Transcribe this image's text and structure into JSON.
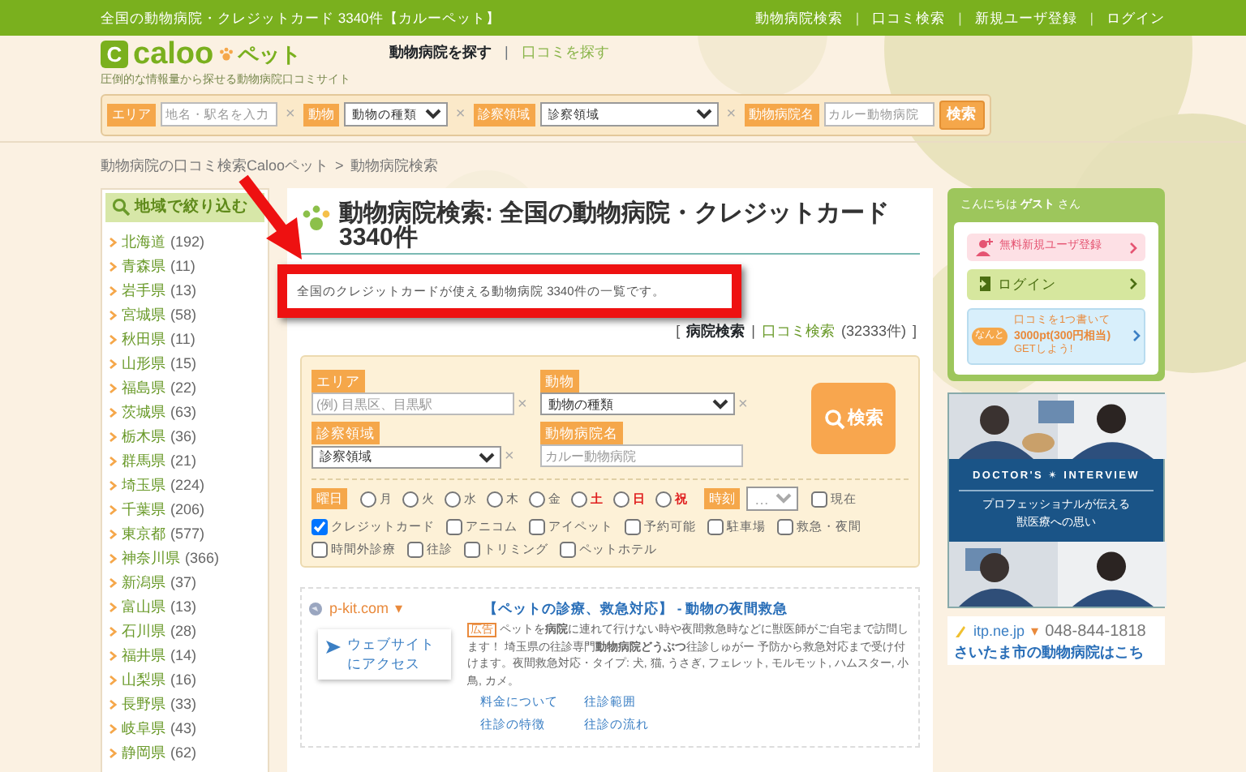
{
  "top_bar": {
    "title": "全国の動物病院・クレジットカード 3340件【カルーペット】",
    "links": [
      "動物病院検索",
      "口コミ検索",
      "新規ユーザ登録",
      "ログイン"
    ],
    "separator": "|"
  },
  "header": {
    "logo": {
      "mark": "C",
      "name": "caloo",
      "suffix": "ペット"
    },
    "tagline": "圧倒的な情報量から探せる動物病院口コミサイト",
    "nav": [
      {
        "label": "動物病院を探す",
        "selected": true
      },
      {
        "label": "口コミを探す",
        "selected": false
      }
    ],
    "separator": "|"
  },
  "search_bar": {
    "fields": [
      {
        "label": "エリア",
        "kind": "input",
        "placeholder": "地名・駅名を入力",
        "clear": "×"
      },
      {
        "label": "動物",
        "kind": "select",
        "value": "動物の種類",
        "clear": "×"
      },
      {
        "label": "診察領域",
        "kind": "select",
        "value": "診察領域",
        "clear": "×"
      },
      {
        "label": "動物病院名",
        "kind": "input",
        "placeholder": "カルー動物病院"
      }
    ],
    "button": "検索"
  },
  "breadcrumb": [
    "動物病院の口コミ検索Calooペット",
    ">",
    "動物病院検索"
  ],
  "sidebar": {
    "heading": "地域で絞り込む",
    "items": [
      {
        "name": "北海道",
        "count": "(192)"
      },
      {
        "name": "青森県",
        "count": "(11)"
      },
      {
        "name": "岩手県",
        "count": "(13)"
      },
      {
        "name": "宮城県",
        "count": "(58)"
      },
      {
        "name": "秋田県",
        "count": "(11)"
      },
      {
        "name": "山形県",
        "count": "(15)"
      },
      {
        "name": "福島県",
        "count": "(22)"
      },
      {
        "name": "茨城県",
        "count": "(63)"
      },
      {
        "name": "栃木県",
        "count": "(36)"
      },
      {
        "name": "群馬県",
        "count": "(21)"
      },
      {
        "name": "埼玉県",
        "count": "(224)"
      },
      {
        "name": "千葉県",
        "count": "(206)"
      },
      {
        "name": "東京都",
        "count": "(577)"
      },
      {
        "name": "神奈川県",
        "count": "(366)"
      },
      {
        "name": "新潟県",
        "count": "(37)"
      },
      {
        "name": "富山県",
        "count": "(13)"
      },
      {
        "name": "石川県",
        "count": "(28)"
      },
      {
        "name": "福井県",
        "count": "(14)"
      },
      {
        "name": "山梨県",
        "count": "(16)"
      },
      {
        "name": "長野県",
        "count": "(33)"
      },
      {
        "name": "岐阜県",
        "count": "(43)"
      },
      {
        "name": "静岡県",
        "count": "(62)"
      }
    ]
  },
  "main": {
    "title": "動物病院検索: 全国の動物病院・クレジットカード 3340件",
    "description": "全国のクレジットカードが使える動物病院 3340件の一覧です。",
    "tabs": [
      {
        "label": "病院検索",
        "selected": true
      },
      {
        "label": "口コミ検索",
        "selected": false,
        "count": "(32333件)"
      }
    ],
    "bracket_open": "[",
    "separator": "|",
    "bracket_close": "]",
    "form": {
      "fields": [
        {
          "label": "エリア",
          "kind": "input",
          "placeholder": "(例) 目黒区、目黒駅",
          "clear": "×"
        },
        {
          "label": "動物",
          "kind": "select",
          "value": "動物の種類",
          "clear": "×"
        },
        {
          "label": "診察領域",
          "kind": "select",
          "value": "診察領域",
          "clear": "×"
        },
        {
          "label": "動物病院名",
          "kind": "input",
          "placeholder": "カルー動物病院"
        }
      ],
      "button": "検索",
      "days_label": "曜日",
      "days": [
        {
          "label": "月",
          "kind": "weekday",
          "selected": false
        },
        {
          "label": "火",
          "kind": "weekday",
          "selected": false
        },
        {
          "label": "水",
          "kind": "weekday",
          "selected": false
        },
        {
          "label": "木",
          "kind": "weekday",
          "selected": false
        },
        {
          "label": "金",
          "kind": "weekday",
          "selected": false
        },
        {
          "label": "土",
          "kind": "holiday",
          "selected": false
        },
        {
          "label": "日",
          "kind": "holiday",
          "selected": false
        },
        {
          "label": "祝",
          "kind": "holiday",
          "selected": false
        }
      ],
      "time_label": "時刻",
      "time_value": "…",
      "now": {
        "label": "現在",
        "checked": false
      },
      "options": [
        {
          "label": "クレジットカード",
          "checked": true
        },
        {
          "label": "アニコム",
          "checked": false
        },
        {
          "label": "アイペット",
          "checked": false
        },
        {
          "label": "予約可能",
          "checked": false
        },
        {
          "label": "駐車場",
          "checked": false
        },
        {
          "label": "救急・夜間",
          "checked": false
        },
        {
          "label": "時間外診療",
          "checked": false
        },
        {
          "label": "往診",
          "checked": false
        },
        {
          "label": "トリミング",
          "checked": false
        },
        {
          "label": "ペットホテル",
          "checked": false
        }
      ]
    },
    "ad": {
      "domain": "p-kit.com",
      "caret": "▾",
      "cta": "ウェブサイトにアクセス",
      "title": "【ペットの診療、救急対応】 - 動物の夜間救急",
      "tag": "広告",
      "body": "ペットを**病院**に連れて行けない時や夜間救急時などに獣医師がご自宅まで訪問します！ 埼玉県の往診専門**動物病院どうぶつ**往診しゅがー 予防から救急対応まで受け付けます。夜間救急対応・タイプ: 犬, 猫, うさぎ, フェレット, モルモット, ハムスター, 小鳥, カメ。",
      "links": [
        "料金について",
        "往診範囲",
        "往診の特徴",
        "往診の流れ"
      ]
    }
  },
  "right": {
    "greeting": "こんにちは **ゲスト** さん",
    "buttons": [
      {
        "kind": "register",
        "label": "無料新規ユーザ登録"
      },
      {
        "kind": "login",
        "label": "ログイン"
      },
      {
        "kind": "promo",
        "badge": "なんと",
        "lines": [
          "口コミを1つ書いて",
          "3000pt(300円相当)",
          "GETしよう!"
        ]
      }
    ],
    "banner": {
      "heading": "DOCTOR'S ✴ INTERVIEW",
      "lines": [
        "プロフェッショナルが伝える",
        "獣医療への思い"
      ]
    },
    "ad": {
      "domain": "itp.ne.jp",
      "caret": "▾",
      "phone": "048-844-1818",
      "title": "さいたま市の動物病院はこち"
    }
  }
}
